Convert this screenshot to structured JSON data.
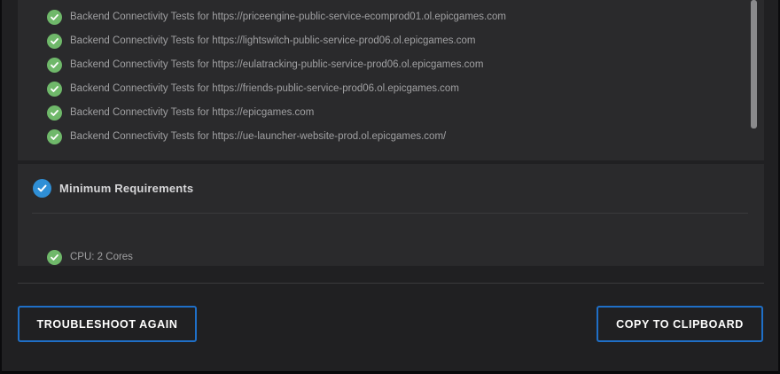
{
  "backend_tests": {
    "items": [
      {
        "label": "Backend Connectivity Tests for https://priceengine-public-service-ecomprod01.ol.epicgames.com"
      },
      {
        "label": "Backend Connectivity Tests for https://lightswitch-public-service-prod06.ol.epicgames.com"
      },
      {
        "label": "Backend Connectivity Tests for https://eulatracking-public-service-prod06.ol.epicgames.com"
      },
      {
        "label": "Backend Connectivity Tests for https://friends-public-service-prod06.ol.epicgames.com"
      },
      {
        "label": "Backend Connectivity Tests for https://epicgames.com"
      },
      {
        "label": "Backend Connectivity Tests for https://ue-launcher-website-prod.ol.epicgames.com/"
      }
    ]
  },
  "minimum_requirements": {
    "title": "Minimum Requirements",
    "items": [
      {
        "label": "CPU: 2 Cores"
      }
    ]
  },
  "buttons": {
    "troubleshoot_label": "TROUBLESHOOT AGAIN",
    "copy_label": "COPY TO CLIPBOARD"
  },
  "colors": {
    "success_green": "#6fb86a",
    "section_check_blue": "#2f8fd6",
    "button_border_blue": "#1f6fc7"
  }
}
